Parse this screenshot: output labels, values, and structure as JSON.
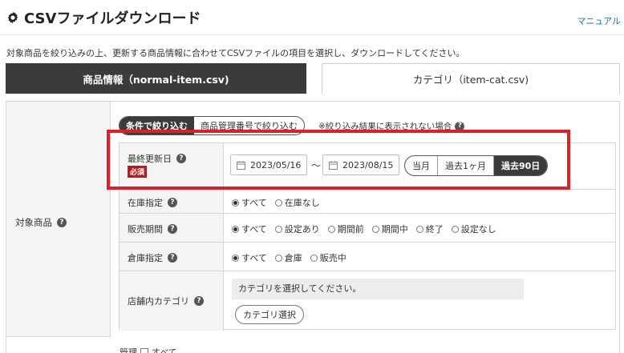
{
  "header": {
    "title": "CSVファイルダウンロード",
    "manual_link": "マニュアル"
  },
  "description": "対象商品を絞り込みの上、更新する商品情報に合わせてCSVファイルの項目を選択し、ダウンロードしてください。",
  "tabs": [
    {
      "label": "商品情報（normal-item.csv)",
      "active": true
    },
    {
      "label": "カテゴリ（item-cat.csv)",
      "active": false
    }
  ],
  "target": {
    "label": "対象商品",
    "filter_modes": [
      {
        "label": "条件で絞り込む",
        "active": true
      },
      {
        "label": "商品管理番号で絞り込む",
        "active": false
      }
    ],
    "filter_note": "※絞り込み結果に表示されない場合"
  },
  "conditions": {
    "last_updated": {
      "label": "最終更新日",
      "required_badge": "必須",
      "from": "2023/05/16",
      "tilde": "～",
      "to": "2023/08/15",
      "ranges": [
        {
          "label": "当月",
          "active": false
        },
        {
          "label": "過去1ヶ月",
          "active": false
        },
        {
          "label": "過去90日",
          "active": true
        }
      ]
    },
    "stock": {
      "label": "在庫指定",
      "options": [
        {
          "label": "すべて",
          "checked": true
        },
        {
          "label": "在庫なし",
          "checked": false
        }
      ]
    },
    "sales_period": {
      "label": "販売期間",
      "options": [
        {
          "label": "すべて",
          "checked": true
        },
        {
          "label": "設定あり",
          "checked": false
        },
        {
          "label": "期間前",
          "checked": false
        },
        {
          "label": "期間中",
          "checked": false
        },
        {
          "label": "終了",
          "checked": false
        },
        {
          "label": "設定なし",
          "checked": false
        }
      ]
    },
    "warehouse": {
      "label": "倉庫指定",
      "options": [
        {
          "label": "すべて",
          "checked": true
        },
        {
          "label": "倉庫",
          "checked": false
        },
        {
          "label": "販売中",
          "checked": false
        }
      ]
    },
    "store_category": {
      "label": "店舗内カテゴリ",
      "placeholder": "カテゴリを選択してください。",
      "button": "カテゴリ選択"
    }
  },
  "bottom": {
    "label": "管理",
    "checkbox_label": "すべて"
  },
  "icons": {
    "title": "gear-icon",
    "help": "help-icon",
    "date": "calendar-icon"
  },
  "colors": {
    "dark": "#3b3b3b",
    "badge": "#b01e23",
    "highlight": "#dd1f26",
    "link": "#2a6fb6"
  }
}
